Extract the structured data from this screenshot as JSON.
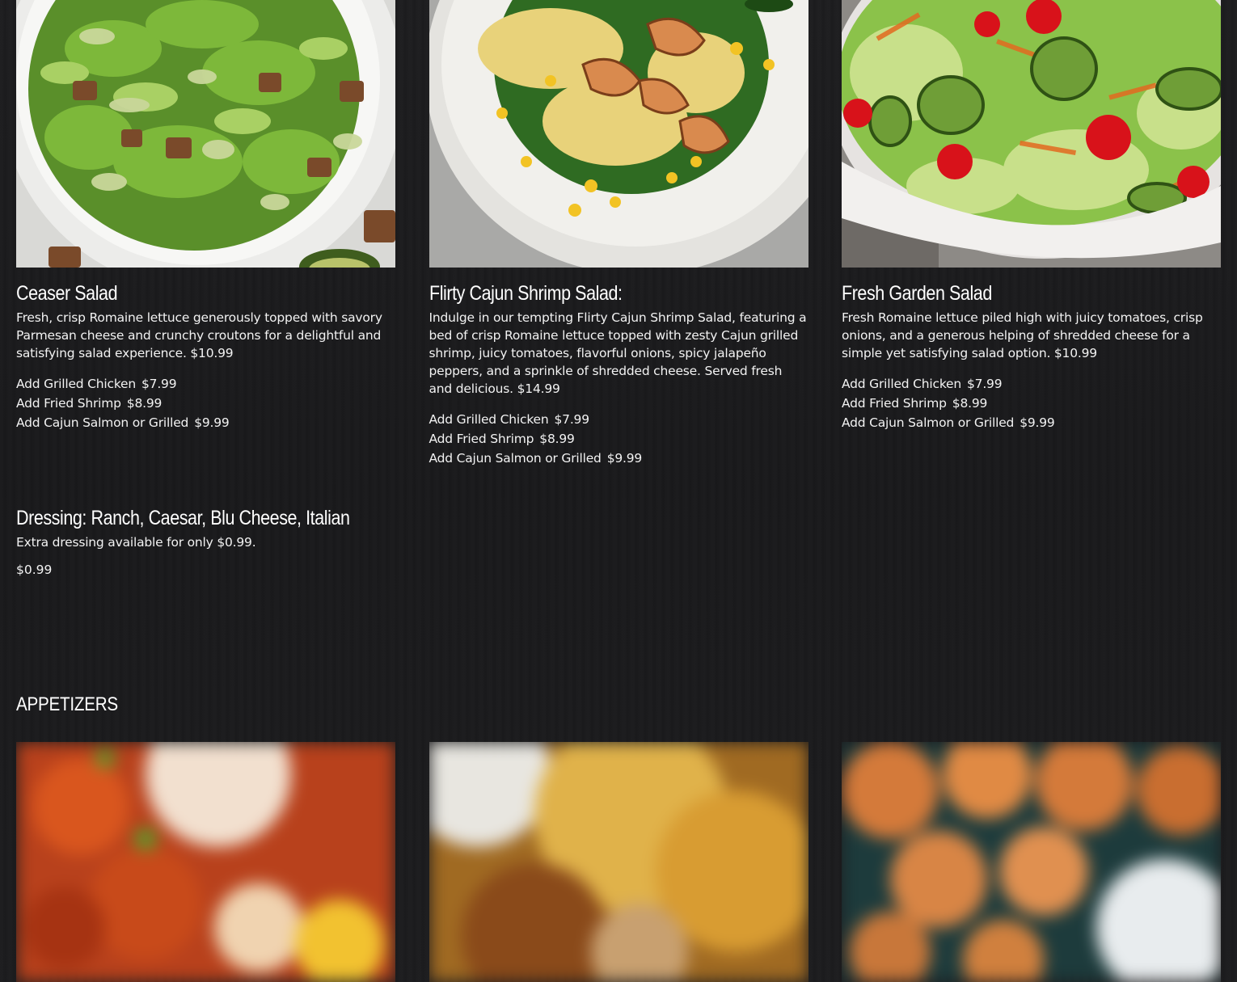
{
  "salads": [
    {
      "title": "Ceaser Salad",
      "photo_icon": "caesar-salad-photo",
      "description": "Fresh, crisp Romaine lettuce generously topped with savory Parmesan cheese and crunchy croutons for a delightful and satisfying salad experience. $10.99",
      "addons": [
        {
          "label": "Add Grilled Chicken",
          "price": "$7.99"
        },
        {
          "label": "Add Fried Shrimp",
          "price": "$8.99"
        },
        {
          "label": "Add Cajun Salmon or Grilled",
          "price": "$9.99"
        }
      ]
    },
    {
      "title": "Flirty Cajun Shrimp Salad:",
      "photo_icon": "shrimp-salad-photo",
      "description": "Indulge in our tempting Flirty Cajun Shrimp Salad, featuring a bed of crisp Romaine lettuce topped with zesty Cajun grilled shrimp, juicy tomatoes, flavorful onions, spicy jalapeño peppers, and a sprinkle of shredded cheese. Served fresh and delicious. $14.99",
      "addons": [
        {
          "label": "Add Grilled Chicken",
          "price": "$7.99"
        },
        {
          "label": "Add Fried Shrimp",
          "price": "$8.99"
        },
        {
          "label": "Add Cajun Salmon or Grilled",
          "price": "$9.99"
        }
      ]
    },
    {
      "title": "Fresh Garden Salad",
      "photo_icon": "garden-salad-photo",
      "description": "Fresh Romaine lettuce piled high with juicy tomatoes, crisp onions, and a generous helping of shredded cheese for a simple yet satisfying salad option. $10.99",
      "addons": [
        {
          "label": "Add Grilled Chicken",
          "price": "$7.99"
        },
        {
          "label": "Add Fried Shrimp",
          "price": "$8.99"
        },
        {
          "label": "Add Cajun Salmon or Grilled",
          "price": "$9.99"
        }
      ]
    }
  ],
  "dressing": {
    "title": "Dressing: Ranch, Caesar, Blu Cheese, Italian",
    "description": "Extra dressing available for only $0.99.",
    "price": "$0.99"
  },
  "appetizers": {
    "section_title": "APPETIZERS",
    "photos": [
      "wings-photo",
      "loaded-fries-photo",
      "fried-bites-photo"
    ]
  },
  "colors": {
    "background": "#1b1b1d",
    "text": "#ffffff"
  }
}
